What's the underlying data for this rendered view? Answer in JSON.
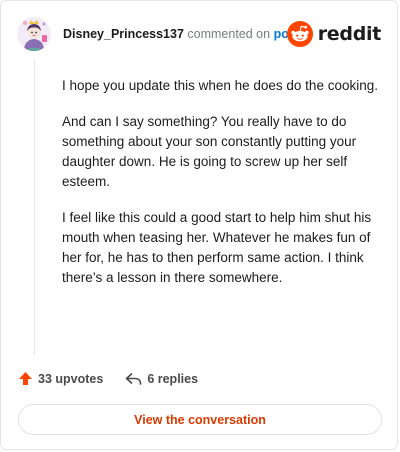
{
  "comment": {
    "username": "Disney_Princess137",
    "verb": "commented on",
    "post_link": "post",
    "paragraphs": [
      "I hope you update this when he does do the cooking.",
      "And can I say something? You really have to do something about your son constantly putting your daughter down. He is going to screw up her self esteem.",
      "I feel like this could a good start to help him shut his mouth when teasing her. Whatever he makes fun of her for, he has to then perform same action. I think there’s a lesson in there somewhere."
    ],
    "upvotes": "33 upvotes",
    "replies": "6 replies",
    "view_button": "View the conversation"
  },
  "brand": {
    "wordmark": "reddit",
    "icon": "reddit-snoo-icon",
    "accent": "#ff4500"
  },
  "colors": {
    "link": "#0079d3",
    "upvote": "#ff4500",
    "view_button_text": "#d93a00",
    "muted": "#787c7e"
  },
  "icons": {
    "avatar": "user-avatar-icon",
    "upvote": "upvote-arrow-icon",
    "reply": "reply-arrow-icon"
  }
}
